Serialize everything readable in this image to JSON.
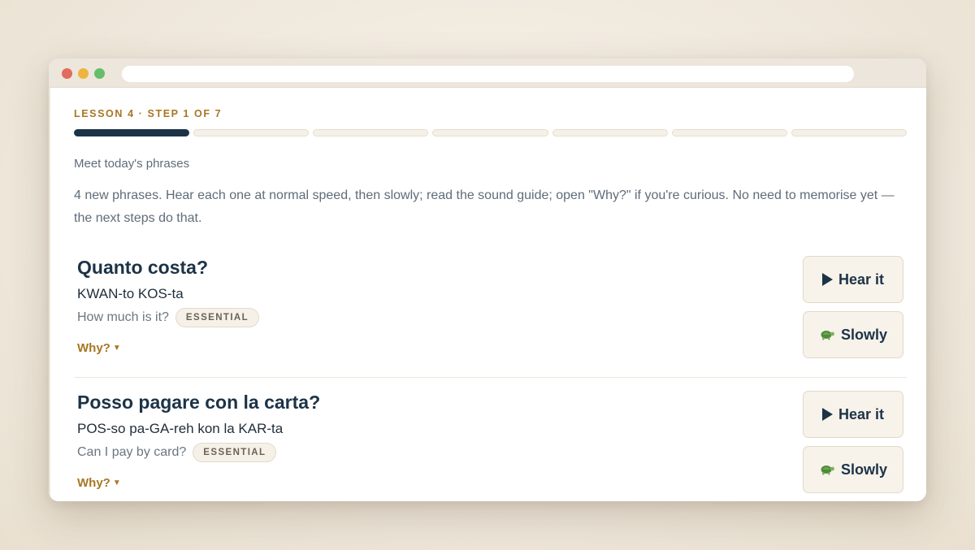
{
  "lesson": {
    "eyebrow": "LESSON 4 · STEP 1 OF 7",
    "progress": {
      "current_step": 1,
      "total_steps": 7
    },
    "intro_title": "Meet today's phrases",
    "intro_text": "4 new phrases. Hear each one at normal speed, then slowly; read the sound guide; open \"Why?\" if you're curious. No need to memorise yet — the next steps do that."
  },
  "phrases": [
    {
      "phrase": "Quanto costa?",
      "sound_guide": "KWAN-to KOS-ta",
      "meaning": "How much is it?",
      "badge": "ESSENTIAL",
      "why_label": "Why?",
      "hear_label": "Hear it",
      "slow_label": "Slowly"
    },
    {
      "phrase": "Posso pagare con la carta?",
      "sound_guide": "POS-so pa-GA-reh kon la KAR-ta",
      "meaning": "Can I pay by card?",
      "badge": "ESSENTIAL",
      "why_label": "Why?",
      "hear_label": "Hear it",
      "slow_label": "Slowly"
    }
  ],
  "icons": {
    "play": "play-icon",
    "turtle": "turtle-icon",
    "caret": "caret-down-icon"
  },
  "colors": {
    "accent": "#a87622",
    "primary": "#1c3347",
    "progress_done": "#1c3347",
    "button_bg": "#f7f2ea"
  }
}
